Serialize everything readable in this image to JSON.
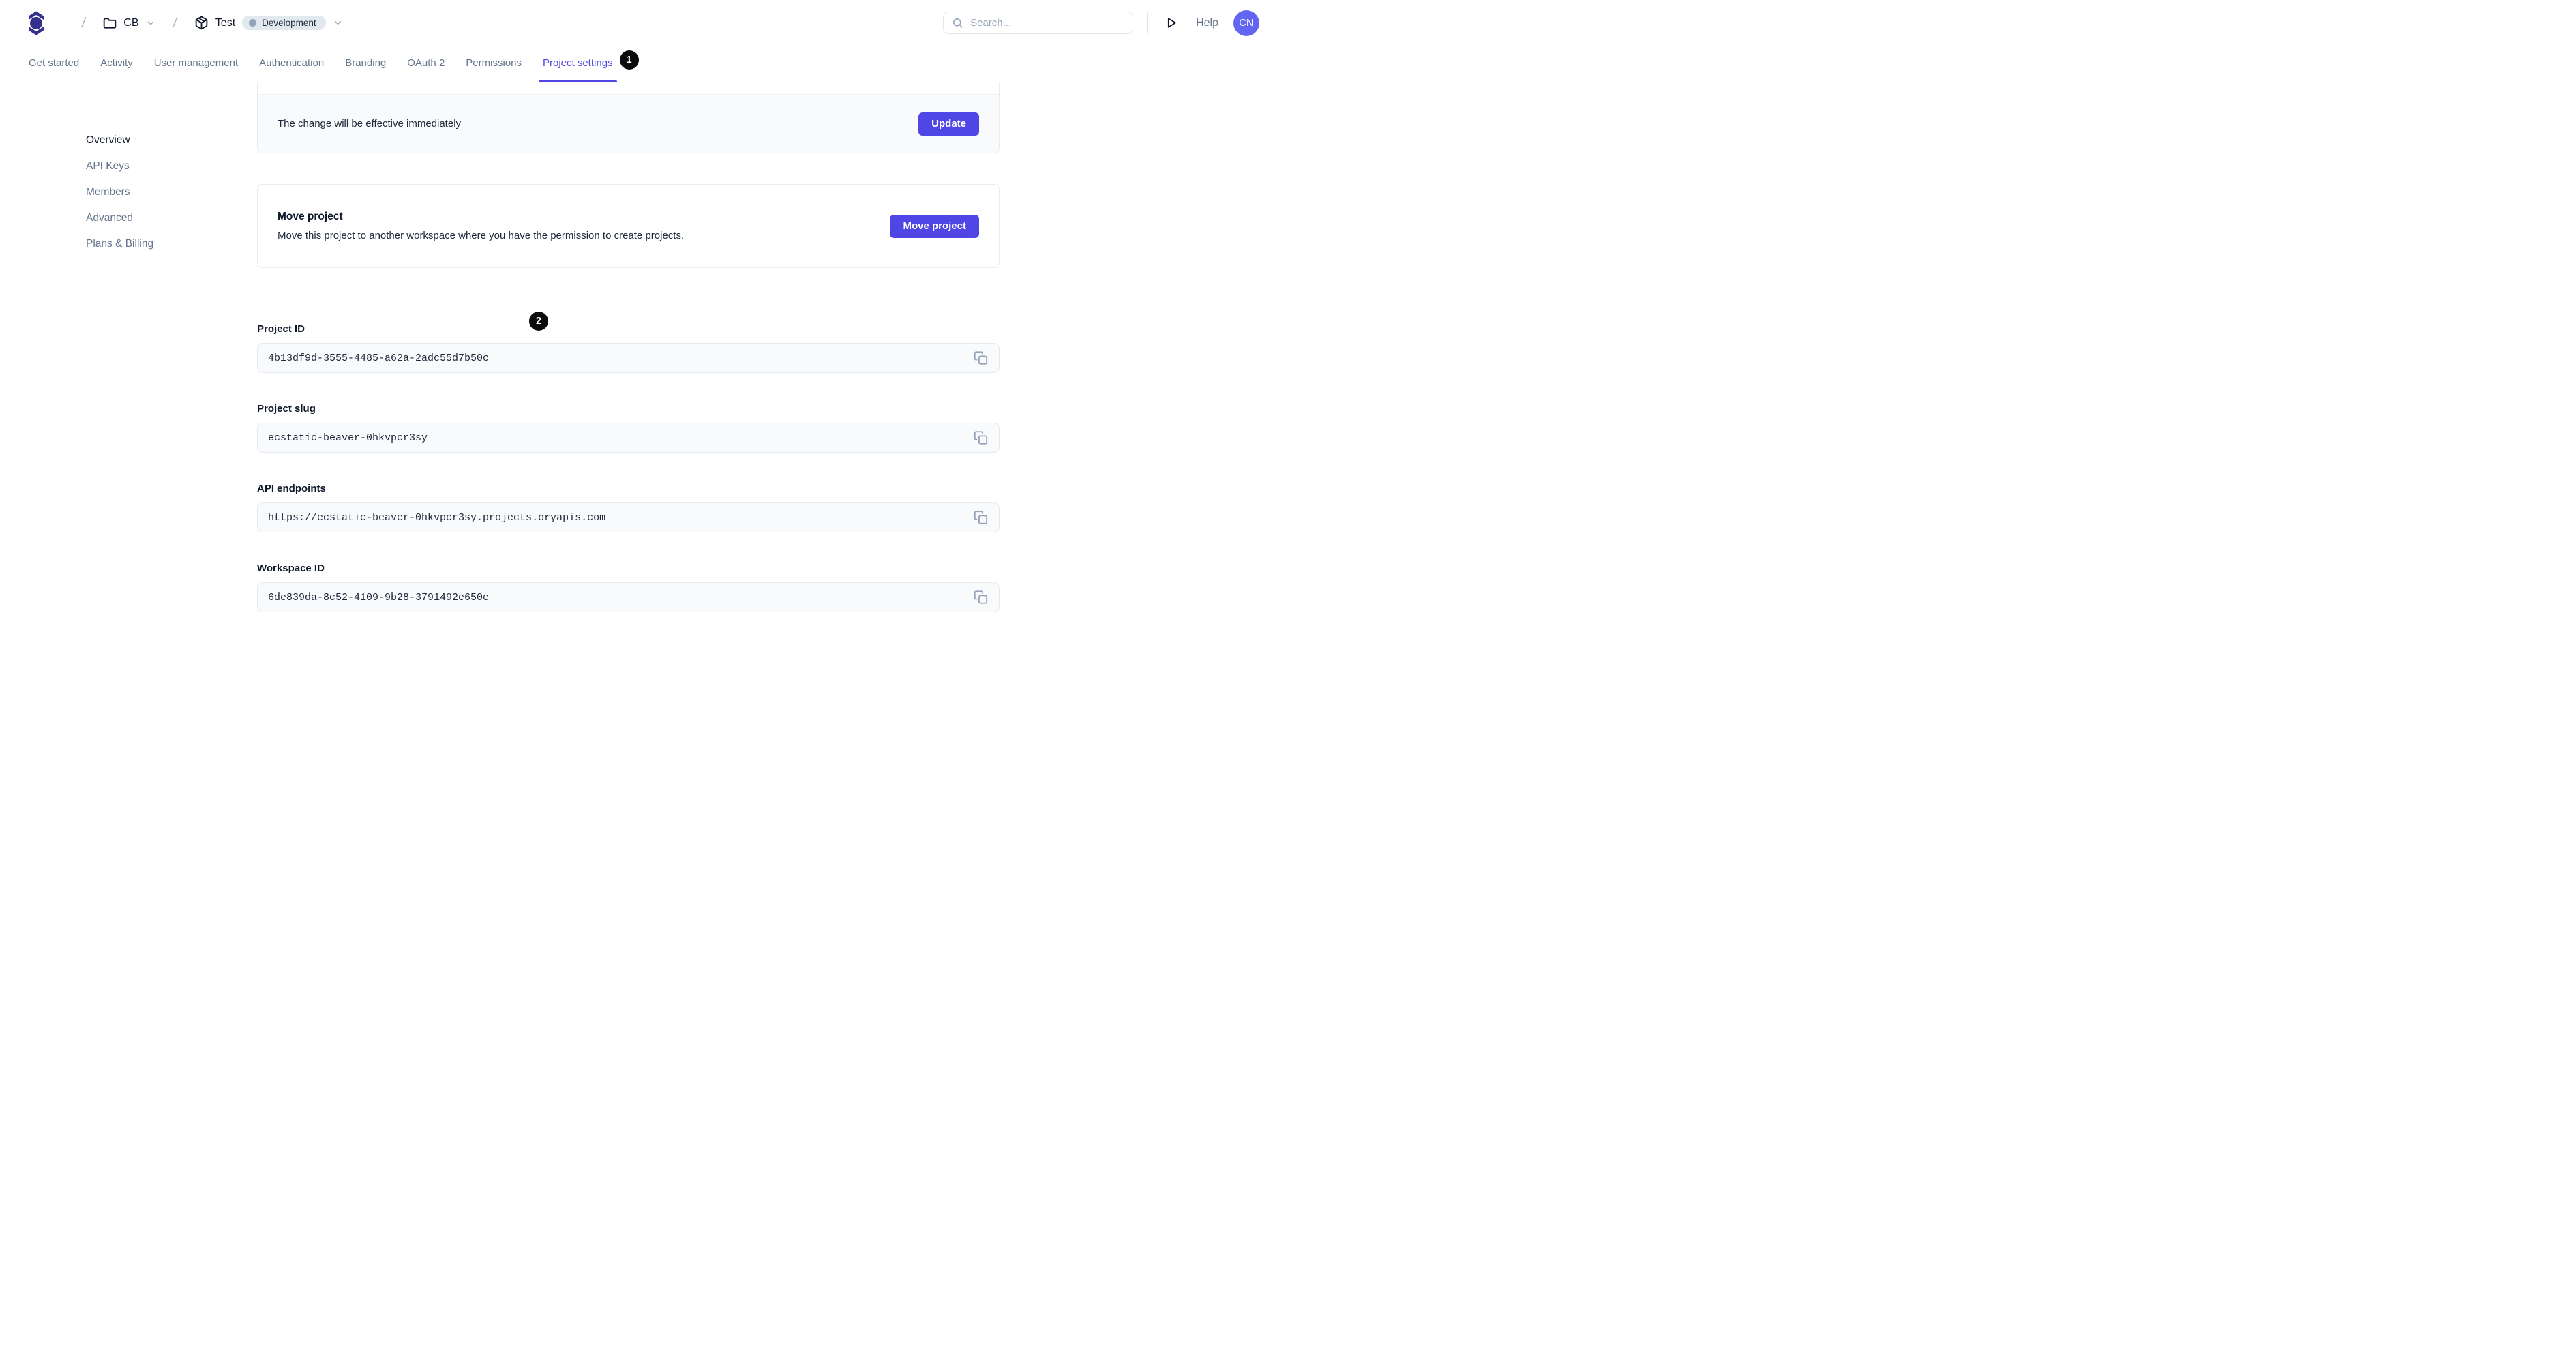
{
  "header": {
    "breadcrumb": {
      "separator": "/",
      "workspace_label": "CB",
      "project_label": "Test",
      "environment_badge": "Development"
    },
    "search": {
      "placeholder": "Search..."
    },
    "help_label": "Help",
    "avatar_initials": "CN"
  },
  "tabs": {
    "items": [
      {
        "label": "Get started",
        "active": false
      },
      {
        "label": "Activity",
        "active": false
      },
      {
        "label": "User management",
        "active": false
      },
      {
        "label": "Authentication",
        "active": false
      },
      {
        "label": "Branding",
        "active": false
      },
      {
        "label": "OAuth 2",
        "active": false
      },
      {
        "label": "Permissions",
        "active": false
      },
      {
        "label": "Project settings",
        "active": true
      }
    ],
    "notification_badge": "1"
  },
  "sidebar": {
    "items": [
      {
        "label": "Overview",
        "active": true
      },
      {
        "label": "API Keys",
        "active": false
      },
      {
        "label": "Members",
        "active": false
      },
      {
        "label": "Advanced",
        "active": false
      },
      {
        "label": "Plans & Billing",
        "active": false
      }
    ]
  },
  "main": {
    "update_card": {
      "message": "The change will be effective immediately",
      "button_label": "Update"
    },
    "move_card": {
      "title": "Move project",
      "description": "Move this project to another workspace where you have the permission to create projects.",
      "button_label": "Move project"
    },
    "step_badge": "2",
    "fields": [
      {
        "label": "Project ID",
        "value": "4b13df9d-3555-4485-a62a-2adc55d7b50c"
      },
      {
        "label": "Project slug",
        "value": "ecstatic-beaver-0hkvpcr3sy"
      },
      {
        "label": "API endpoints",
        "value": "https://ecstatic-beaver-0hkvpcr3sy.projects.oryapis.com"
      },
      {
        "label": "Workspace ID",
        "value": "6de839da-8c52-4109-9b28-3791492e650e"
      }
    ]
  },
  "colors": {
    "accent": "#4f46e5",
    "logo": "#34308d",
    "avatar_bg": "#6366f1",
    "badge_bg": "#0b0b0e",
    "env_pill_bg": "#e2e8f0",
    "env_dot": "#94a3b8",
    "border": "#e2e8f0",
    "field_bg": "#f8fafc",
    "muted_text": "#64748b"
  }
}
